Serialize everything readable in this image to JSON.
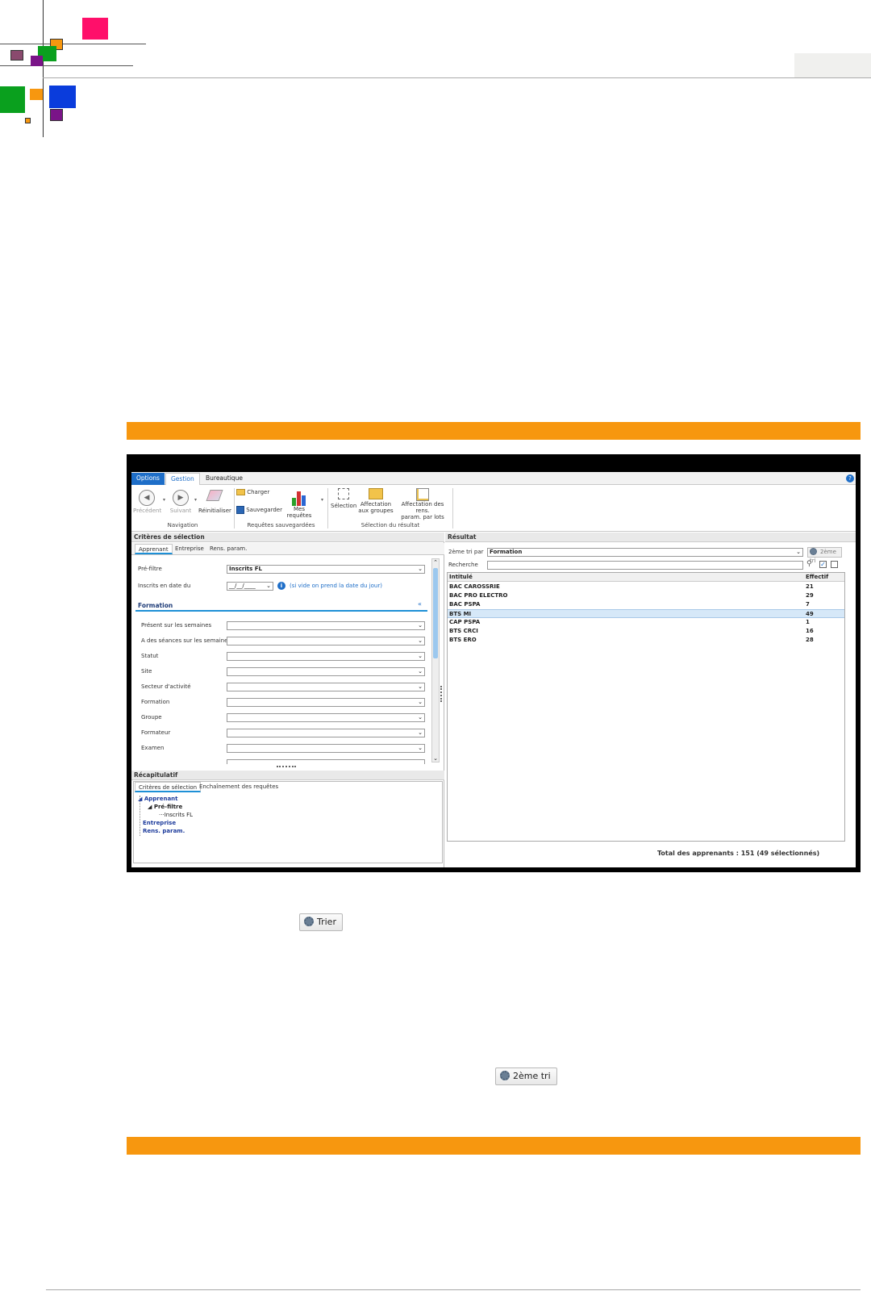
{
  "colors": {
    "accent_orange": "#f7970f",
    "pink": "#ff0f6a",
    "green": "#0aa01e",
    "blue": "#0a3cdc",
    "purple": "#7a1488",
    "mauve": "#8a4a6e",
    "app_blue": "#1e6ec8"
  },
  "app": {
    "tabs": [
      "Options",
      "Gestion",
      "Bureautique"
    ],
    "ribbon": {
      "navigation": {
        "precedent": "Précédent",
        "suivant": "Suivant",
        "reinitialiser": "Réinitialiser",
        "group_label": "Navigation"
      },
      "requetes": {
        "charger": "Charger",
        "sauvegarder": "Sauvegarder",
        "mes_requetes": "Mes requêtes",
        "group_label": "Requêtes sauvegardées"
      },
      "selection": {
        "selection": "Sélection",
        "affectation_groupes_1": "Affectation",
        "affectation_groupes_2": "aux groupes",
        "affectation_rens_1": "Affectation des rens.",
        "affectation_rens_2": "param. par lots",
        "group_label": "Sélection du résultat"
      }
    },
    "criteres": {
      "title": "Critères de sélection",
      "tabs": [
        "Apprenant",
        "Entreprise",
        "Rens. param."
      ],
      "prefiltre_label": "Pré-filtre",
      "prefiltre_value": "Inscrits FL",
      "inscrits_label": "Inscrits en date du",
      "date_placeholder": "__/__/____",
      "date_hint": "(si vide on prend la date du jour)",
      "formation_section": "Formation",
      "fields": [
        "Présent sur les semaines",
        "A des séances sur les semaines",
        "Statut",
        "Site",
        "Secteur d'activité",
        "Formation",
        "Groupe",
        "Formateur",
        "Examen"
      ]
    },
    "recap": {
      "title": "Récapitulatif",
      "tabs": [
        "Critères de sélection",
        "Enchaînement des requêtes"
      ],
      "tree": {
        "apprenant": "Apprenant",
        "prefiltre": "Pré-filtre",
        "inscrits": "Inscrits FL",
        "entreprise": "Entreprise",
        "rens": "Rens. param."
      }
    },
    "resultat": {
      "title": "Résultat",
      "tri_label": "2ème tri par",
      "tri_value": "Formation",
      "tri_button": "2ème tri",
      "recherche_label": "Recherche",
      "col_intitule": "Intitulé",
      "col_effectif": "Effectif",
      "rows": [
        {
          "intitule": "BAC CAROSSRIE",
          "effectif": "21"
        },
        {
          "intitule": "BAC PRO ELECTRO",
          "effectif": "29"
        },
        {
          "intitule": "BAC PSPA",
          "effectif": "7"
        },
        {
          "intitule": "BTS MI",
          "effectif": "49"
        },
        {
          "intitule": "CAP PSPA",
          "effectif": "1"
        },
        {
          "intitule": "BTS CRCI",
          "effectif": "16"
        },
        {
          "intitule": "BTS ERO",
          "effectif": "28"
        }
      ],
      "selected_row": "BTS MI",
      "total": "Total des apprenants : 151 (49 sélectionnés)"
    }
  },
  "buttons": {
    "trier": "Trier",
    "deuxieme_tri": "2ème tri"
  }
}
